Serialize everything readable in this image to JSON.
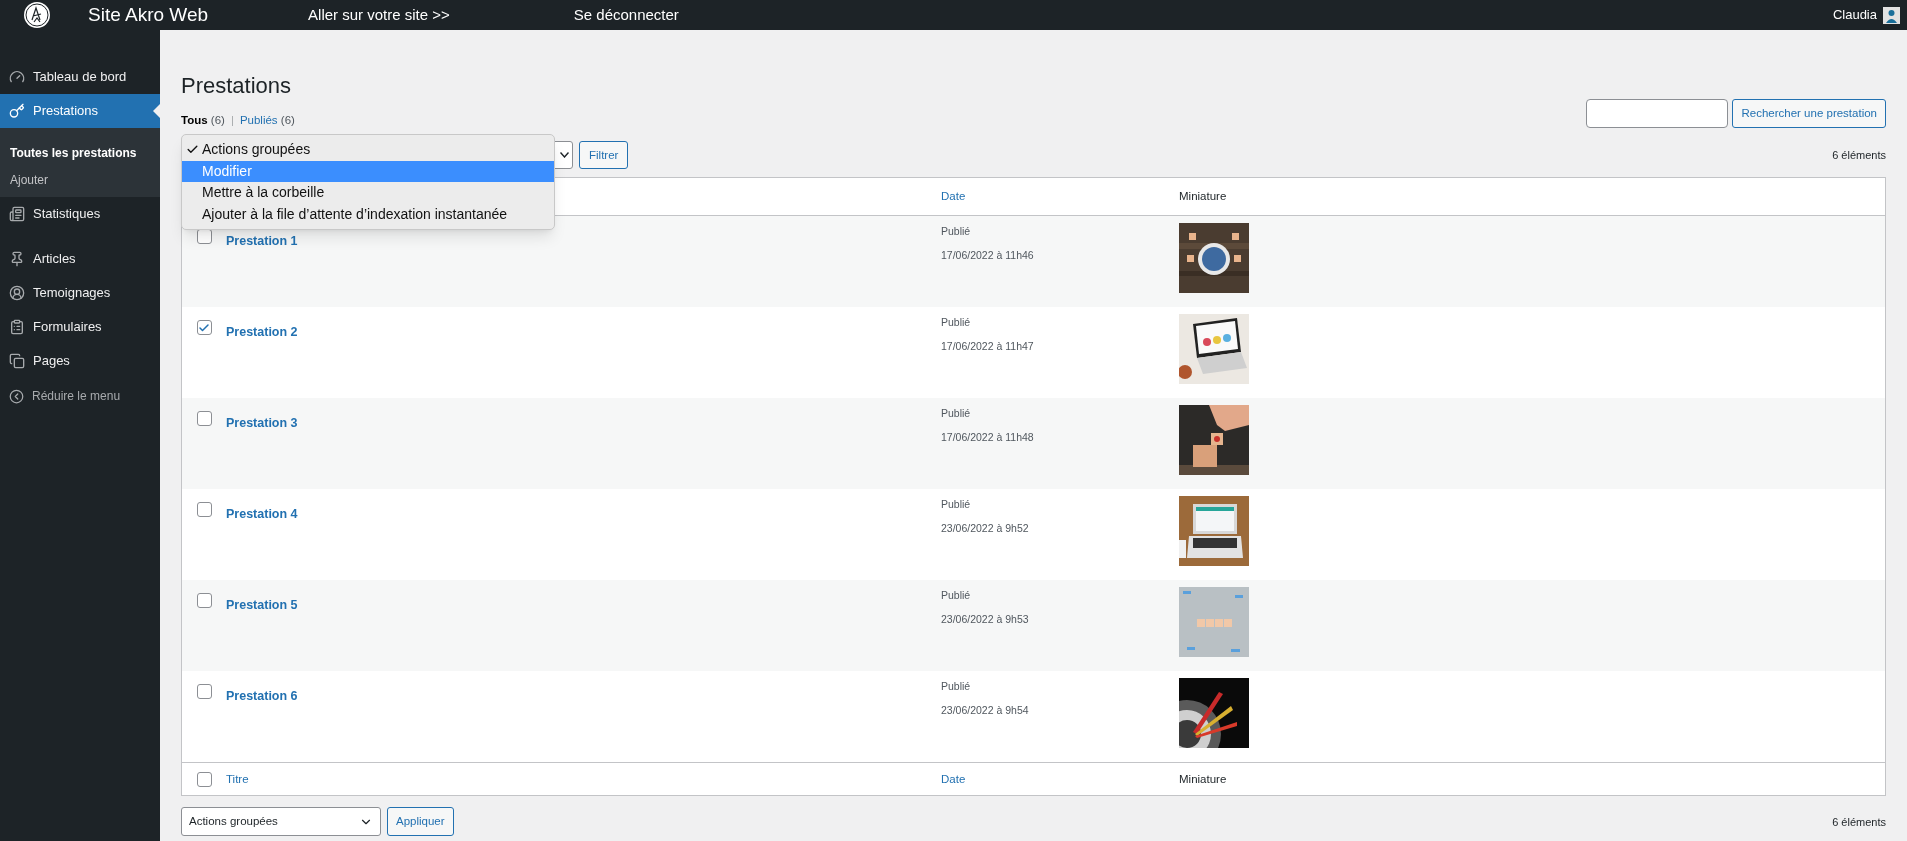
{
  "top_bar": {
    "site_title": "Site Akro Web",
    "links": [
      "Aller sur votre site >>",
      "Se déconnecter"
    ],
    "user": "Claudia"
  },
  "sidebar": {
    "items": [
      {
        "label": "Tableau de bord",
        "selected": false
      },
      {
        "label": "Prestations",
        "selected": true,
        "children": [
          {
            "label": "Toutes les prestations",
            "selected": true
          },
          {
            "label": "Ajouter",
            "selected": false
          }
        ]
      },
      {
        "label": "Statistiques",
        "selected": false
      },
      {
        "label": "Articles",
        "selected": false
      },
      {
        "label": "Temoignages",
        "selected": false
      },
      {
        "label": "Formulaires",
        "selected": false
      },
      {
        "label": "Pages",
        "selected": false
      }
    ],
    "collapse_label": "Réduire le menu"
  },
  "page": {
    "title": "Prestations",
    "filters": [
      {
        "label": "Tous",
        "count": "(6)",
        "selected": true
      },
      {
        "label": "Publiés",
        "count": "(6)",
        "selected": false
      }
    ],
    "separator": "|",
    "search_button": "Rechercher une prestation",
    "filter_button": "Filtrer",
    "count": "6 éléments",
    "bulk_menu": [
      {
        "label": "Actions groupées",
        "selected": true,
        "highlighted": false
      },
      {
        "label": "Modifier",
        "selected": false,
        "highlighted": true
      },
      {
        "label": "Mettre à la corbeille",
        "selected": false,
        "highlighted": false
      },
      {
        "label": "Ajouter à la file d’attente d’indexation instantanée",
        "selected": false,
        "highlighted": false
      }
    ]
  },
  "table": {
    "header_columns": [
      "Date",
      "Miniature"
    ],
    "rows": [
      {
        "title": "Prestation 1",
        "checked": false,
        "status": "Publié",
        "date": "17/06/2022 à 11h46"
      },
      {
        "title": "Prestation 2",
        "checked": true,
        "status": "Publié",
        "date": "17/06/2022 à 11h47"
      },
      {
        "title": "Prestation 3",
        "checked": false,
        "status": "Publié",
        "date": "17/06/2022 à 11h48"
      },
      {
        "title": "Prestation 4",
        "checked": false,
        "status": "Publié",
        "date": "23/06/2022 à 9h52"
      },
      {
        "title": "Prestation 5",
        "checked": false,
        "status": "Publié",
        "date": "23/06/2022 à 9h53"
      },
      {
        "title": "Prestation 6",
        "checked": false,
        "status": "Publié",
        "date": "23/06/2022 à 9h54"
      }
    ],
    "footer_select_all": {
      "checked": false
    },
    "footer_columns": [
      "Titre",
      "Date",
      "Miniature"
    ]
  },
  "bottom": {
    "bulk_select": "Actions groupées",
    "apply_button": "Appliquer",
    "count": "6 éléments"
  }
}
